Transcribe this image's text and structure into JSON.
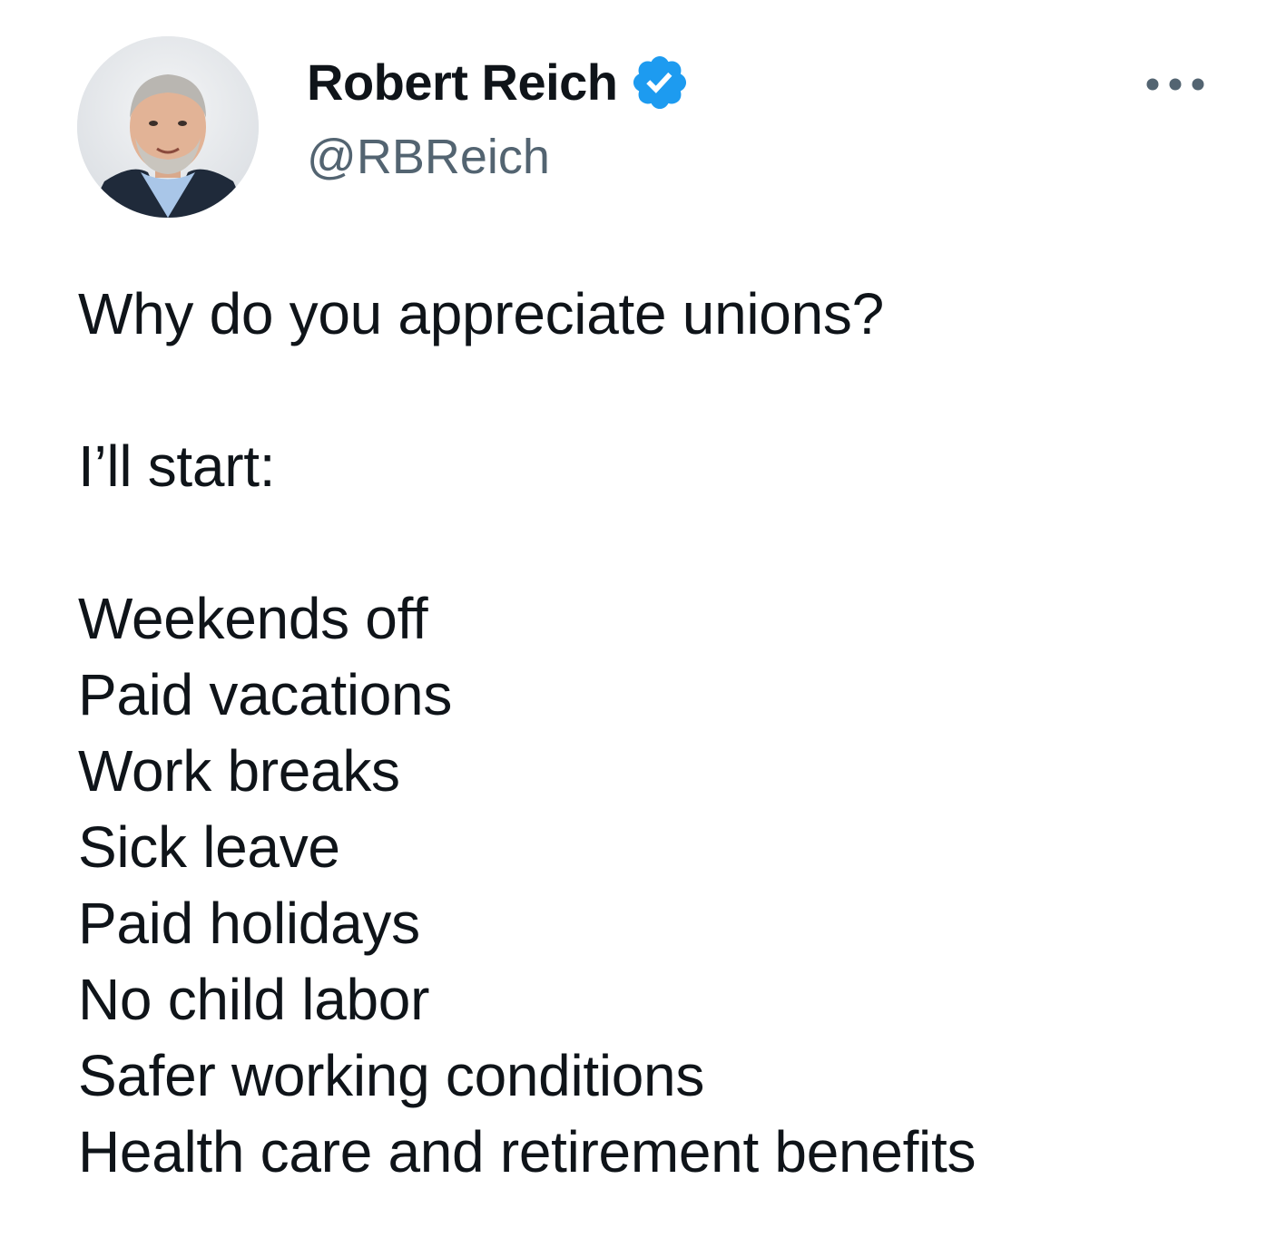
{
  "author": {
    "name": "Robert Reich",
    "handle": "@RBReich",
    "verified": true,
    "avatar_icon": "profile-photo",
    "verified_icon": "verified-badge-icon"
  },
  "menu": {
    "more_icon": "more-options-icon"
  },
  "tweet": {
    "question": "Why do you appreciate unions?",
    "intro": "I’ll start:",
    "items": [
      "Weekends off",
      "Paid vacations",
      "Work breaks",
      "Sick leave",
      "Paid holidays",
      "No child labor",
      "Safer working conditions",
      "Health care and retirement benefits"
    ]
  },
  "colors": {
    "text": "#0f1419",
    "secondary_text": "#536471",
    "verified_blue": "#1d9bf0",
    "background": "#ffffff"
  }
}
